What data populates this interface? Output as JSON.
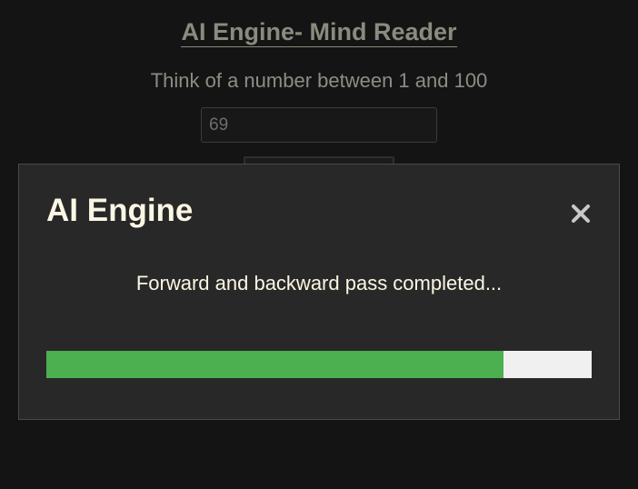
{
  "page": {
    "title": "AI Engine- Mind Reader",
    "prompt": "Think of a number between 1 and 100",
    "number_input": {
      "value": "69"
    }
  },
  "modal": {
    "title": "AI Engine",
    "close_icon": "close-icon",
    "message": "Forward and backward pass completed...",
    "progress_fraction": 0.838
  },
  "colors": {
    "background": "#141414",
    "modal_background": "#282828",
    "progress_fill": "#4caf50",
    "progress_track": "#f0f0f0",
    "modal_text": "#fbf7e4",
    "page_text": "#8a8a7e"
  }
}
